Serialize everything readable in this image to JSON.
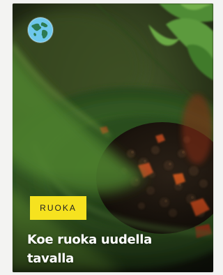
{
  "card": {
    "image_subject": "food-photo",
    "category_badge_icon": "globe-icon",
    "category": "RUOKA",
    "headline": "Koe ruoka uudella tavalla"
  },
  "colors": {
    "tag_background": "#f6e21f",
    "globe_badge": "#6ec7ec",
    "headline_text": "#ffffff"
  }
}
